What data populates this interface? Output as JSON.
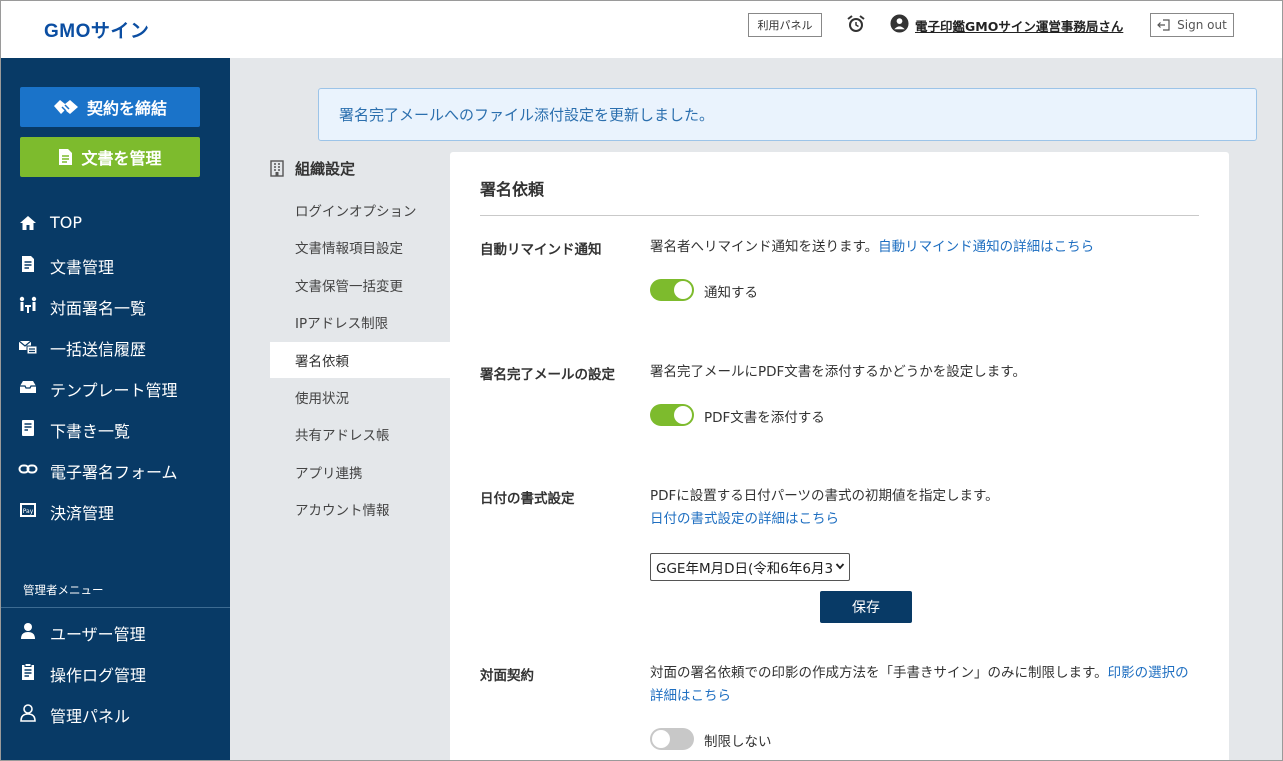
{
  "header": {
    "logo": "GMOサイン",
    "panel_button": "利用パネル",
    "user_name": "電子印鑑GMOサイン運営事務局さん",
    "signout": "Sign out"
  },
  "sidebar": {
    "contract_button": "契約を締結",
    "docs_button": "文書を管理",
    "items": [
      {
        "label": "TOP",
        "icon": "home-icon"
      },
      {
        "label": "文書管理",
        "icon": "document-icon"
      },
      {
        "label": "対面署名一覧",
        "icon": "face-to-face-icon"
      },
      {
        "label": "一括送信履歴",
        "icon": "bulk-send-icon"
      },
      {
        "label": "テンプレート管理",
        "icon": "template-icon"
      },
      {
        "label": "下書き一覧",
        "icon": "draft-icon"
      },
      {
        "label": "電子署名フォーム",
        "icon": "link-icon"
      },
      {
        "label": "決済管理",
        "icon": "pay-icon"
      }
    ],
    "admin_label": "管理者メニュー",
    "admin_items": [
      {
        "label": "ユーザー管理",
        "icon": "user-icon"
      },
      {
        "label": "操作ログ管理",
        "icon": "log-icon"
      },
      {
        "label": "管理パネル",
        "icon": "admin-panel-icon"
      }
    ],
    "colors": {
      "bg": "#083a66",
      "contract": "#1a73c9",
      "docs": "#7dbb2d"
    }
  },
  "alert": {
    "message": "署名完了メールへのファイル添付設定を更新しました。"
  },
  "subnav": {
    "heading": "組織設定",
    "items": [
      {
        "label": "ログインオプション"
      },
      {
        "label": "文書情報項目設定"
      },
      {
        "label": "文書保管一括変更"
      },
      {
        "label": "IPアドレス制限"
      },
      {
        "label": "署名依頼",
        "active": true
      },
      {
        "label": "使用状況"
      },
      {
        "label": "共有アドレス帳"
      },
      {
        "label": "アプリ連携"
      },
      {
        "label": "アカウント情報"
      }
    ]
  },
  "panel": {
    "title": "署名依頼",
    "remind": {
      "label": "自動リマインド通知",
      "desc": "署名者へリマインド通知を送ります。",
      "link": "自動リマインド通知の詳細はこちら",
      "toggle_label": "通知する",
      "toggle_on": true
    },
    "complete_mail": {
      "label": "署名完了メールの設定",
      "desc": "署名完了メールにPDF文書を添付するかどうかを設定します。",
      "toggle_label": "PDF文書を添付する",
      "toggle_on": true
    },
    "date_format": {
      "label": "日付の書式設定",
      "desc": "PDFに設置する日付パーツの書式の初期値を指定します。",
      "link": "日付の書式設定の詳細はこちら",
      "select_value": "GGE年M月D日(令和6年6月3",
      "save_button": "保存"
    },
    "face_to_face": {
      "label": "対面契約",
      "desc": "対面の署名依頼での印影の作成方法を「手書きサイン」のみに制限します。",
      "link": "印影の選択の詳細はこちら",
      "toggle_label": "制限しない",
      "toggle_on": false
    }
  }
}
